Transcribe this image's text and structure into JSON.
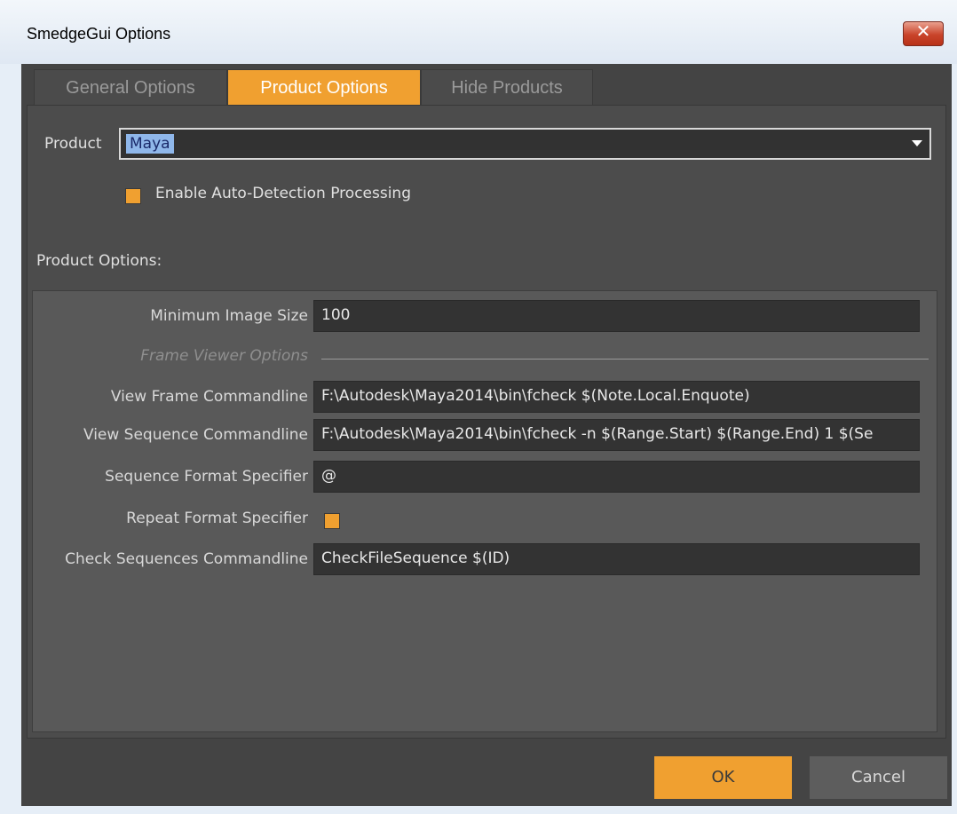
{
  "window": {
    "title": "SmedgeGui Options",
    "close_glyph": "✕"
  },
  "tabs": [
    {
      "label": "General Options",
      "active": false
    },
    {
      "label": "Product Options",
      "active": true
    },
    {
      "label": "Hide Products",
      "active": false
    }
  ],
  "product": {
    "label": "Product",
    "selected": "Maya"
  },
  "auto_detect": {
    "label": "Enable Auto-Detection Processing",
    "checked": true
  },
  "product_options": {
    "heading": "Product Options:",
    "minimum_image_size": {
      "label": "Minimum Image Size",
      "value": "100"
    },
    "frame_viewer_section": "Frame Viewer Options",
    "view_frame": {
      "label": "View Frame Commandline",
      "value": "F:\\Autodesk\\Maya2014\\bin\\fcheck $(Note.Local.Enquote)"
    },
    "view_sequence": {
      "label": "View Sequence Commandline",
      "value": "F:\\Autodesk\\Maya2014\\bin\\fcheck -n $(Range.Start) $(Range.End) 1 $(Se"
    },
    "sequence_format": {
      "label": "Sequence Format Specifier",
      "value": "@"
    },
    "repeat_format": {
      "label": "Repeat Format Specifier",
      "checked": true
    },
    "check_sequences": {
      "label": "Check Sequences Commandline",
      "value": "CheckFileSequence $(ID)"
    }
  },
  "buttons": {
    "ok": "OK",
    "cancel": "Cancel"
  },
  "colors": {
    "accent": "#f0a030",
    "background": "#444444"
  }
}
